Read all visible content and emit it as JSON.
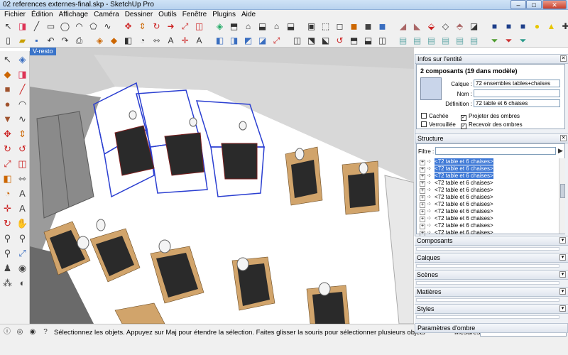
{
  "window": {
    "title": "02 references externes-final.skp - SketchUp Pro"
  },
  "menu": [
    "Fichier",
    "Édition",
    "Affichage",
    "Caméra",
    "Dessiner",
    "Outils",
    "Fenêtre",
    "Plugins",
    "Aide"
  ],
  "viewport": {
    "tab_label": "V-resto"
  },
  "entity_info": {
    "title": "Infos sur l'entité",
    "heading": "2 composants (19 dans modèle)",
    "layer_label": "Calque :",
    "layer_value": "72 ensembles tables+chaises",
    "name_label": "Nom :",
    "name_value": "",
    "definition_label": "Définition :",
    "definition_value": "72 table et 6 chaises",
    "hidden_label": "Cachée",
    "locked_label": "Verrouillée",
    "cast_shadows_label": "Projeter des ombres",
    "receive_shadows_label": "Recevoir des ombres",
    "cast_shadows_checked": true,
    "receive_shadows_checked": true
  },
  "outliner": {
    "title": "Structure",
    "filter_label": "Filtre :",
    "filter_value": "",
    "items": [
      {
        "label": "<72 table et 6 chaises>",
        "selected": true
      },
      {
        "label": "<72 table et 6 chaises>",
        "selected": true
      },
      {
        "label": "<72 table et 6 chaises>",
        "selected": true
      },
      {
        "label": "<72 table et 6 chaises>",
        "selected": false
      },
      {
        "label": "<72 table et 6 chaises>",
        "selected": false
      },
      {
        "label": "<72 table et 6 chaises>",
        "selected": false
      },
      {
        "label": "<72 table et 6 chaises>",
        "selected": false
      },
      {
        "label": "<72 table et 6 chaises>",
        "selected": false
      },
      {
        "label": "<72 table et 6 chaises>",
        "selected": false
      },
      {
        "label": "<72 table et 6 chaises>",
        "selected": false
      },
      {
        "label": "<72 table et 6 chaises>",
        "selected": false
      }
    ]
  },
  "panels": {
    "components": "Composants",
    "layers": "Calques",
    "scenes": "Scènes",
    "materials": "Matières",
    "styles": "Styles",
    "shadows": "Paramètres d'ombre"
  },
  "status": {
    "message": "Sélectionnez les objets. Appuyez sur Maj pour étendre la sélection. Faites glisser la souris pour sélectionner plusieurs objets",
    "measures_label": "Mesures",
    "measures_value": ""
  },
  "colors": {
    "selection_blue": "#2b3fd1",
    "selected_row": "#3d78d6",
    "table_wood": "#d1a46b",
    "table_top": "#2a2a2a",
    "floor": "#ffffff"
  }
}
